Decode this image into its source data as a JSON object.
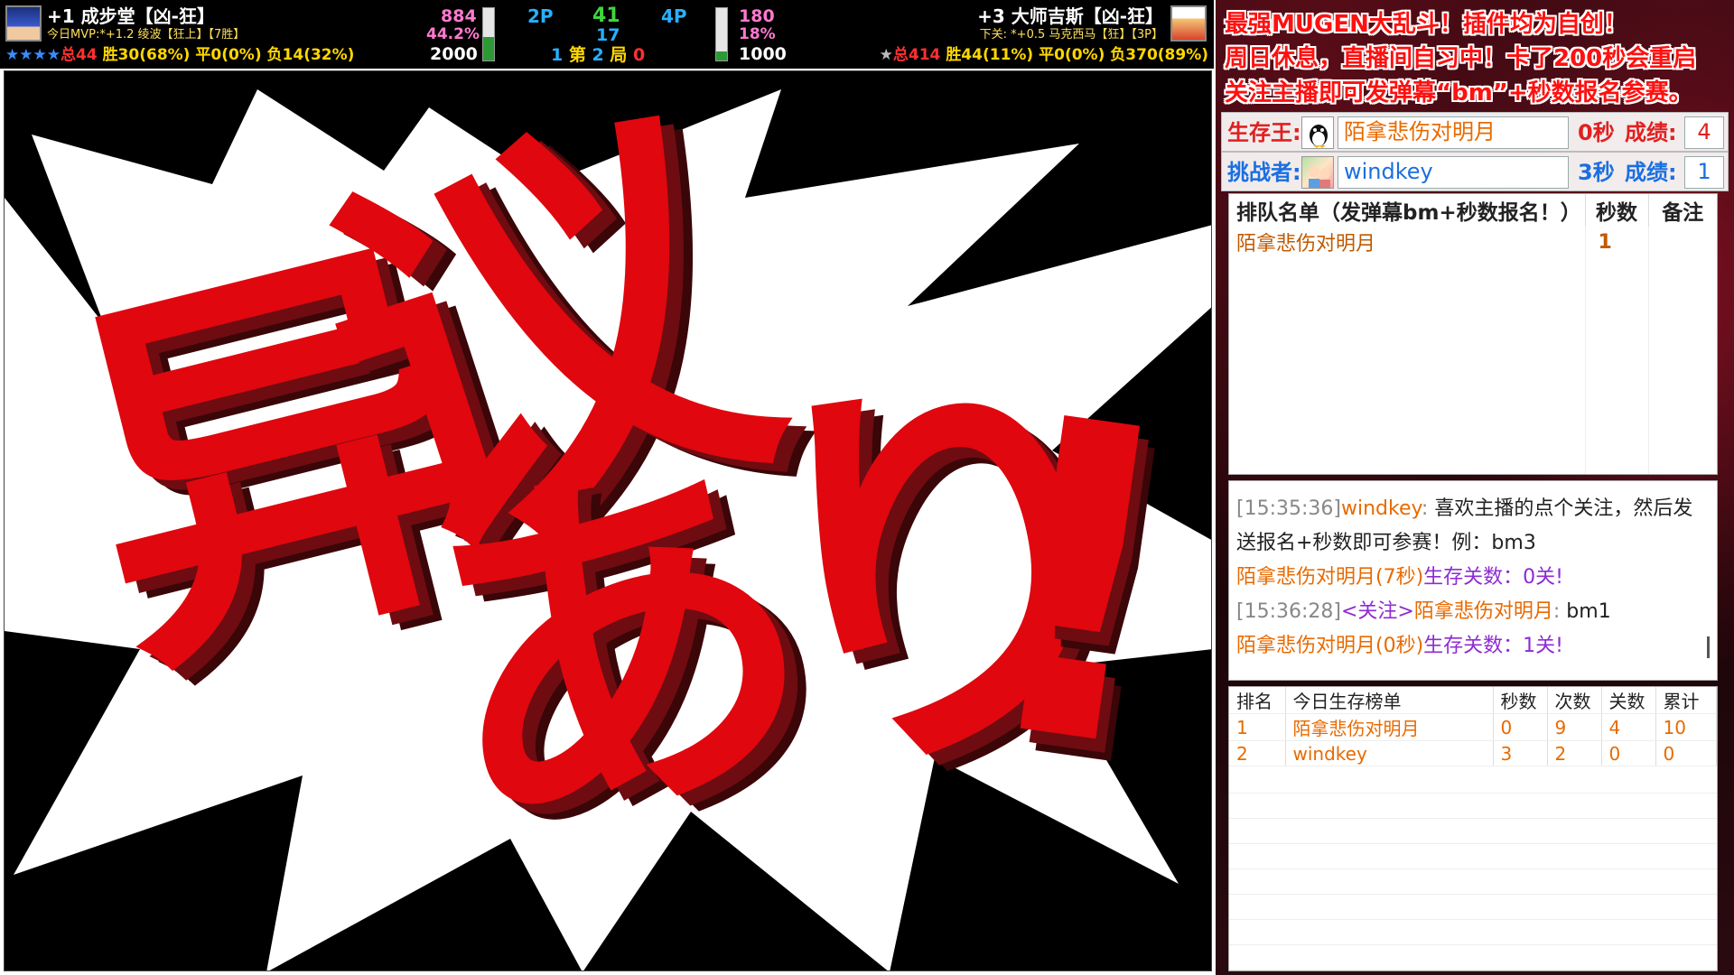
{
  "hud": {
    "p1": {
      "title": "+1 成步堂【凶-狂】",
      "mvp": "今日MVP:*+1.2 绫波【狂上】【7胜】",
      "stars": "★★★★",
      "total": "总44",
      "wins": "胜30(68%)",
      "draws": "平0(0%)",
      "losses": "负14(32%)",
      "hp": "884",
      "hp_pct": "44.2%",
      "max": "2000",
      "hp_fraction": 0.442
    },
    "p2": {
      "title": "+3 大师吉斯【凶-狂】",
      "next": "下关: *+0.5 马克西马【狂】【3P】",
      "stars": "★",
      "total": "总414",
      "wins": "胜44(11%)",
      "draws": "平0(0%)",
      "losses": "负370(89%)",
      "hp": "180",
      "hp_pct": "18%",
      "max": "1000",
      "hp_fraction": 0.18
    },
    "label_2p": "2P",
    "label_4p": "4P",
    "timer": "41",
    "timer2": "17",
    "round_prefix": "1",
    "round_di": "第",
    "round_num": "2",
    "round_ju": "局",
    "round_score": "0"
  },
  "game": {
    "splash_text": "异议あり!"
  },
  "panel": {
    "banner": [
      "最强MUGEN大乱斗！插件均为自创！",
      "周日休息，直播间自习中！卡了200秒会重启",
      "关注主播即可发弹幕“bm”+秒数报名参赛。"
    ],
    "survivor": {
      "label": "生存王:",
      "name": "陌拿悲伤对明月",
      "seconds": "0秒",
      "score_label": "成绩:",
      "score": "4"
    },
    "challenger": {
      "label": "挑战者:",
      "name": "windkey",
      "seconds": "3秒",
      "score_label": "成绩:",
      "score": "1"
    },
    "queue": {
      "header_name": "排队名单（发弹幕bm+秒数报名！）",
      "header_seconds": "秒数",
      "header_note": "备注",
      "rows": [
        {
          "name": "陌拿悲伤对明月",
          "seconds": "1",
          "note": ""
        }
      ]
    },
    "chat": [
      {
        "time": "[15:35:36]",
        "user": "windkey",
        "sep": ":",
        "text": "喜欢主播的点个关注，然后发"
      },
      {
        "text": "送报名+秒数即可参赛！例：bm3"
      },
      {
        "user": "陌拿悲伤对明月(7秒)",
        "text": "生存关数：0关!"
      },
      {
        "time": "[15:36:28]",
        "tag": "<关注>",
        "user": "陌拿悲伤对明月",
        "sep": ":",
        "text": "bm1"
      },
      {
        "user": "陌拿悲伤对明月(0秒)",
        "text": "生存关数：1关!"
      }
    ],
    "ranking": {
      "headers": [
        "排名",
        "今日生存榜单",
        "秒数",
        "次数",
        "关数",
        "累计"
      ],
      "rows": [
        [
          "1",
          "陌拿悲伤对明月",
          "0",
          "9",
          "4",
          "10"
        ],
        [
          "2",
          "windkey",
          "3",
          "2",
          "0",
          "0"
        ]
      ]
    }
  },
  "colors": {
    "splash_red": "#e0070e",
    "splash_dark": "#6e0c12",
    "hp_green": "#2b9a34",
    "username_orange": "#e86a00",
    "chat_purple": "#8e2bd3",
    "score_red": "#e02020",
    "challenger_blue": "#1a6fe0"
  }
}
